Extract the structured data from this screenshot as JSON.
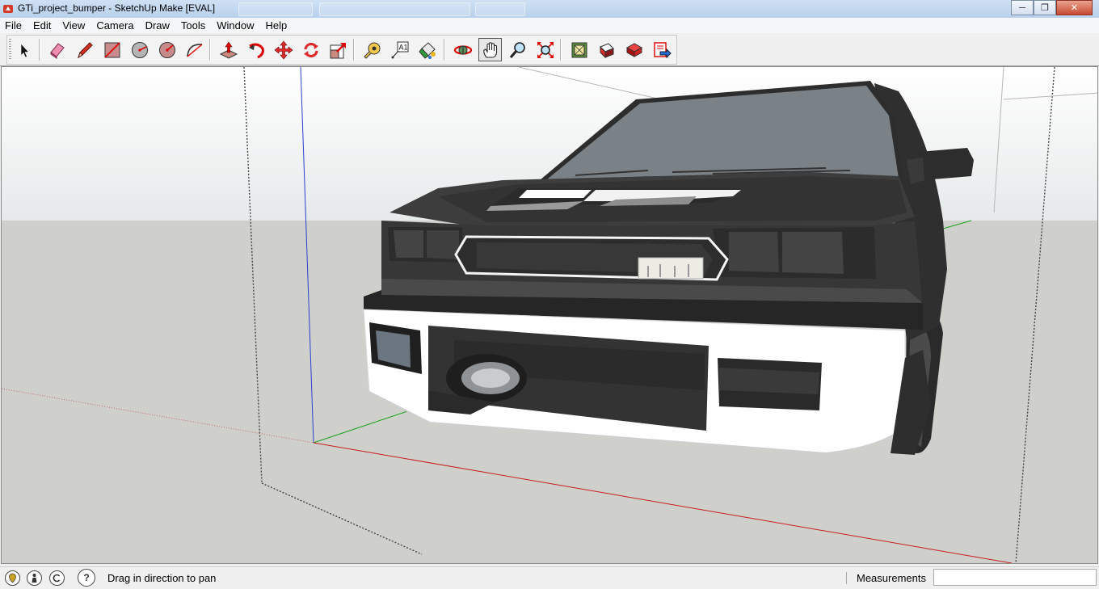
{
  "window": {
    "title": "GTi_project_bumper - SketchUp Make [EVAL]",
    "controls": [
      "minimize",
      "maximize",
      "close"
    ]
  },
  "menu": [
    "File",
    "Edit",
    "View",
    "Camera",
    "Draw",
    "Tools",
    "Window",
    "Help"
  ],
  "toolbar": {
    "tools": [
      {
        "name": "select-tool",
        "icon": "arrow-cursor-icon"
      },
      {
        "name": "eraser-tool",
        "icon": "eraser-icon"
      },
      {
        "name": "line-tool",
        "icon": "pencil-icon"
      },
      {
        "name": "rectangle-tool",
        "icon": "rectangle-icon"
      },
      {
        "name": "circle-tool",
        "icon": "circle-icon"
      },
      {
        "name": "polygon-tool",
        "icon": "polygon-icon"
      },
      {
        "name": "arc-tool",
        "icon": "arc-icon"
      },
      {
        "name": "push-pull-tool",
        "icon": "push-pull-icon"
      },
      {
        "name": "follow-me-tool",
        "icon": "follow-me-icon"
      },
      {
        "name": "move-tool",
        "icon": "move-arrows-icon"
      },
      {
        "name": "rotate-tool",
        "icon": "rotate-icon"
      },
      {
        "name": "scale-tool",
        "icon": "scale-icon"
      },
      {
        "name": "tape-measure-tool",
        "icon": "tape-measure-icon"
      },
      {
        "name": "text-tool",
        "icon": "text-label-icon"
      },
      {
        "name": "paint-bucket-tool",
        "icon": "paint-bucket-icon"
      },
      {
        "name": "orbit-tool",
        "icon": "orbit-icon"
      },
      {
        "name": "pan-tool",
        "icon": "hand-icon",
        "active": true
      },
      {
        "name": "zoom-tool",
        "icon": "magnifier-icon"
      },
      {
        "name": "zoom-extents-tool",
        "icon": "zoom-extents-icon"
      },
      {
        "name": "3d-warehouse-button",
        "icon": "warehouse-icon"
      },
      {
        "name": "share-model-button",
        "icon": "share-model-icon"
      },
      {
        "name": "share-component-button",
        "icon": "share-component-icon"
      },
      {
        "name": "extension-warehouse-button",
        "icon": "extension-icon"
      }
    ]
  },
  "viewport": {
    "description_icon": "3d-car-model",
    "colors": {
      "sky": "#f4f6f6",
      "ground": "#cfcfcb",
      "body": "#3a3a3a",
      "bumper": "#ffffff"
    }
  },
  "status": {
    "icons": [
      "geo-location-icon",
      "credits-icon",
      "copyright-icon",
      "help-icon"
    ],
    "help_glyph": "?",
    "text": "Drag in direction to pan",
    "measurements_label": "Measurements",
    "measurements_value": ""
  }
}
